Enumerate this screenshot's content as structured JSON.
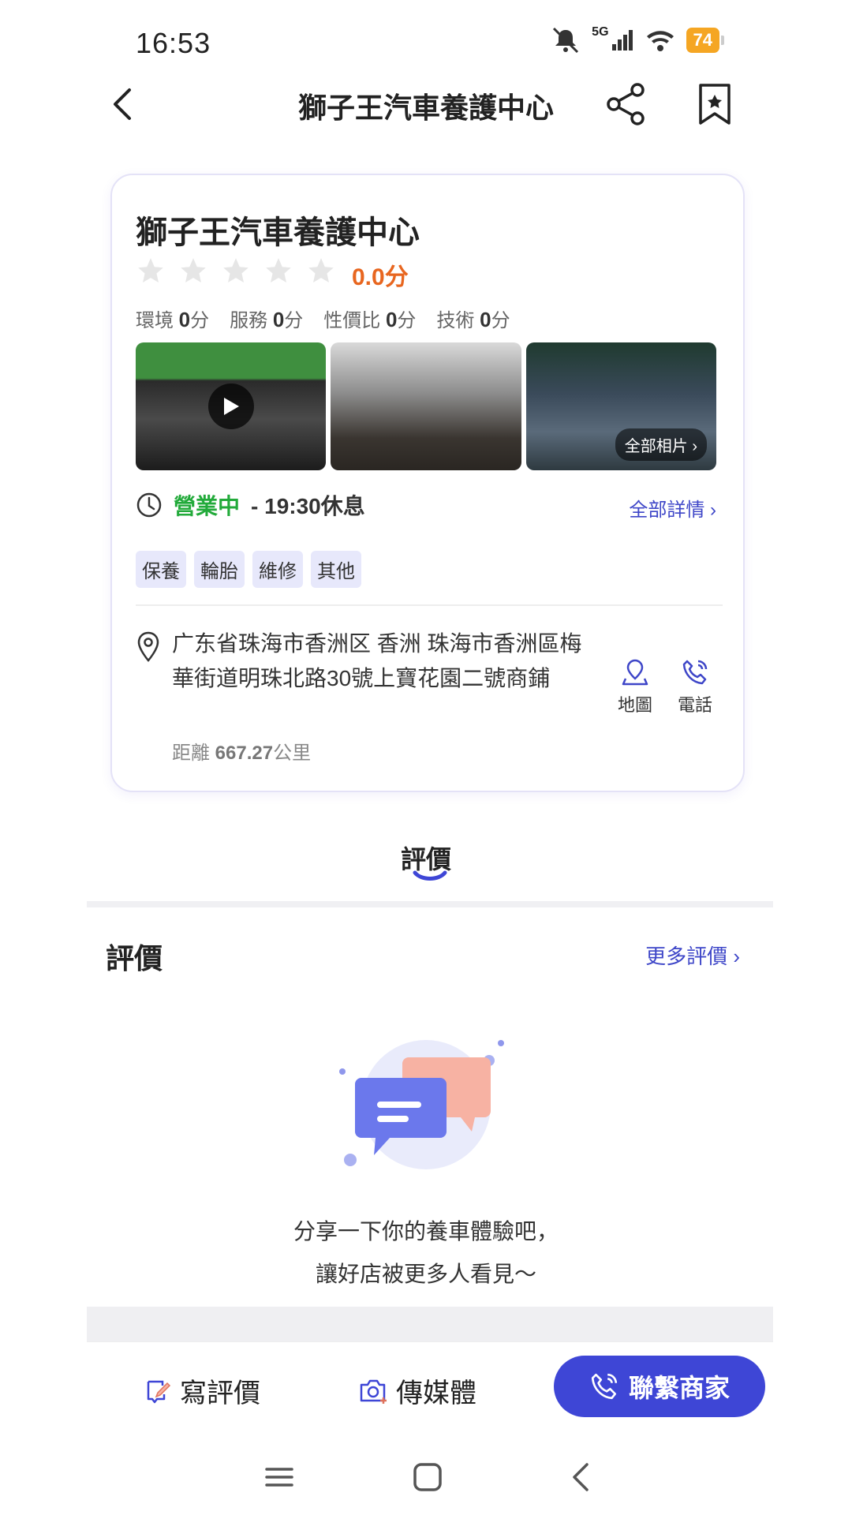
{
  "status_bar": {
    "time": "16:53",
    "network": "5G",
    "battery": "74"
  },
  "header": {
    "title": "獅子王汽車養護中心"
  },
  "shop": {
    "name": "獅子王汽車養護中心",
    "rating": 0,
    "score_text": "0.0分",
    "subscores": [
      {
        "label": "環境",
        "value": "0",
        "unit": "分"
      },
      {
        "label": "服務",
        "value": "0",
        "unit": "分"
      },
      {
        "label": "性價比",
        "value": "0",
        "unit": "分"
      },
      {
        "label": "技術",
        "value": "0",
        "unit": "分"
      }
    ],
    "all_photos": "全部相片",
    "status": "營業中",
    "hours": "- 19:30休息",
    "all_details": "全部詳情",
    "tags": [
      "保養",
      "輪胎",
      "維修",
      "其他"
    ],
    "address": "广东省珠海市香洲区 香洲 珠海市香洲區梅華街道明珠北路30號上寶花園二號商鋪",
    "distance_label": "距離",
    "distance_value": "667.27",
    "distance_unit": "公里",
    "map_label": "地圖",
    "phone_label": "電話"
  },
  "tabs": [
    {
      "label": "評價",
      "active": true
    }
  ],
  "reviews": {
    "title": "評價",
    "more": "更多評價",
    "empty_line1": "分享一下你的養車體驗吧，",
    "empty_line2": "讓好店被更多人看見～"
  },
  "bottom_bar": {
    "write_review": "寫評價",
    "upload_media": "傳媒體",
    "contact": "聯繫商家"
  },
  "colors": {
    "accent": "#3e46d6",
    "score_orange": "#e8661f",
    "open_green": "#22aa3a",
    "tag_bg": "#e7e8fb"
  }
}
